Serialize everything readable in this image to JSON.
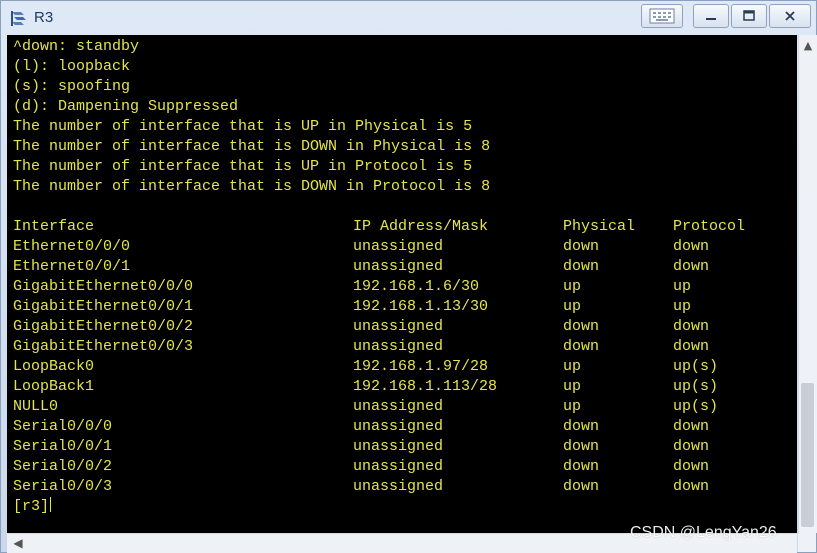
{
  "window": {
    "title": "R3"
  },
  "terminal": {
    "legend_lines": [
      "^down: standby",
      "(l): loopback",
      "(s): spoofing",
      "(d): Dampening Suppressed",
      "The number of interface that is UP in Physical is 5",
      "The number of interface that is DOWN in Physical is 8",
      "The number of interface that is UP in Protocol is 5",
      "The number of interface that is DOWN in Protocol is 8"
    ],
    "headers": {
      "interface": "Interface",
      "ip": "IP Address/Mask",
      "physical": "Physical",
      "protocol": "Protocol"
    },
    "rows": [
      {
        "interface": "Ethernet0/0/0",
        "ip": "unassigned",
        "physical": "down",
        "protocol": "down"
      },
      {
        "interface": "Ethernet0/0/1",
        "ip": "unassigned",
        "physical": "down",
        "protocol": "down"
      },
      {
        "interface": "GigabitEthernet0/0/0",
        "ip": "192.168.1.6/30",
        "physical": "up",
        "protocol": "up"
      },
      {
        "interface": "GigabitEthernet0/0/1",
        "ip": "192.168.1.13/30",
        "physical": "up",
        "protocol": "up"
      },
      {
        "interface": "GigabitEthernet0/0/2",
        "ip": "unassigned",
        "physical": "down",
        "protocol": "down"
      },
      {
        "interface": "GigabitEthernet0/0/3",
        "ip": "unassigned",
        "physical": "down",
        "protocol": "down"
      },
      {
        "interface": "LoopBack0",
        "ip": "192.168.1.97/28",
        "physical": "up",
        "protocol": "up(s)"
      },
      {
        "interface": "LoopBack1",
        "ip": "192.168.1.113/28",
        "physical": "up",
        "protocol": "up(s)"
      },
      {
        "interface": "NULL0",
        "ip": "unassigned",
        "physical": "up",
        "protocol": "up(s)"
      },
      {
        "interface": "Serial0/0/0",
        "ip": "unassigned",
        "physical": "down",
        "protocol": "down"
      },
      {
        "interface": "Serial0/0/1",
        "ip": "unassigned",
        "physical": "down",
        "protocol": "down"
      },
      {
        "interface": "Serial0/0/2",
        "ip": "unassigned",
        "physical": "down",
        "protocol": "down"
      },
      {
        "interface": "Serial0/0/3",
        "ip": "unassigned",
        "physical": "down",
        "protocol": "down"
      }
    ],
    "prompt": "[r3]"
  },
  "watermark": "CSDN @LengYan26",
  "colors": {
    "terminal_bg": "#000000",
    "terminal_text": "#e4e450"
  },
  "icons": {
    "app": "router-app-icon",
    "keyboard": "keyboard-icon",
    "minimize": "minimize-icon",
    "maximize": "maximize-icon",
    "close": "close-icon"
  }
}
